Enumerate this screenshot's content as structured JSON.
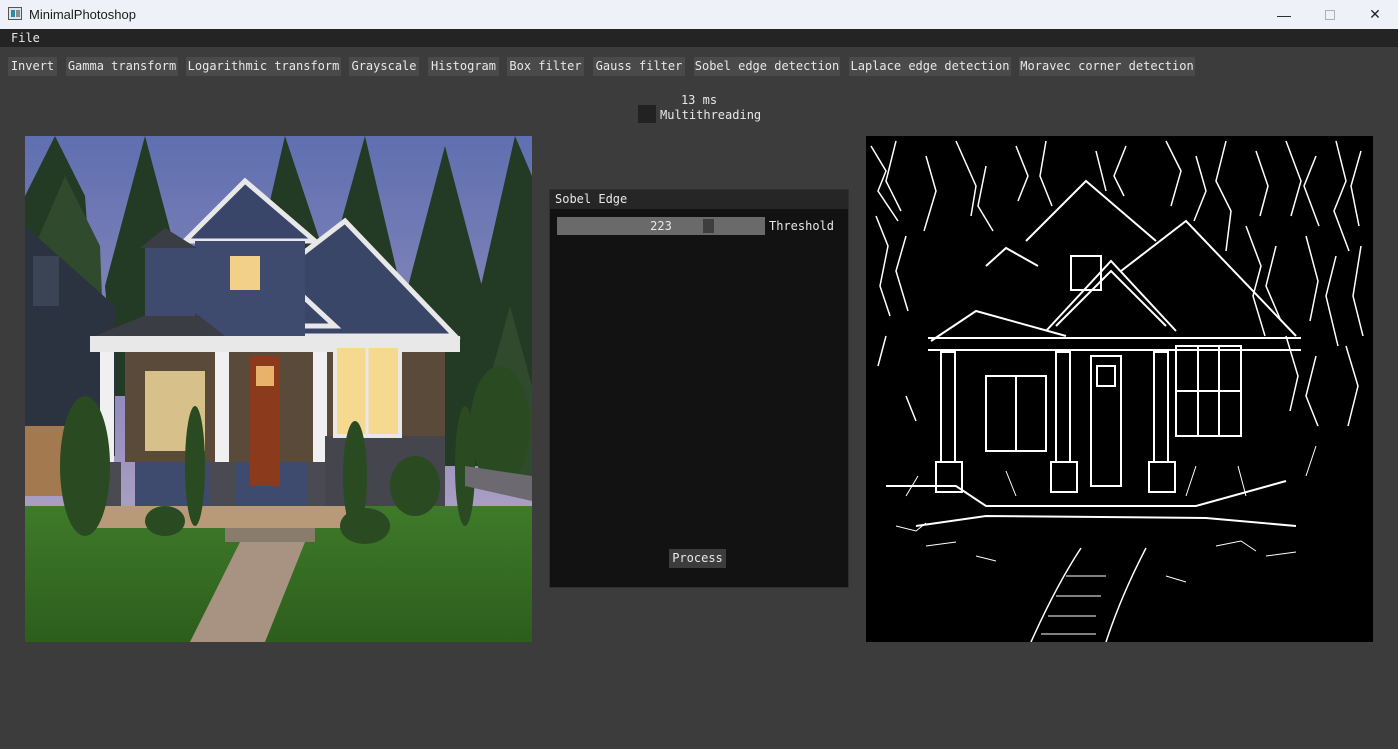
{
  "window": {
    "title": "MinimalPhotoshop",
    "minimize_glyph": "—",
    "close_glyph": "✕"
  },
  "menu": {
    "file": "File"
  },
  "toolbar": [
    "Invert",
    "Gamma transform",
    "Logarithmic transform",
    "Grayscale",
    "Histogram",
    "Box filter",
    "Gauss filter",
    "Sobel edge detection",
    "Laplace edge detection",
    "Moravec corner detection"
  ],
  "status": {
    "time": "13 ms",
    "multithreading_label": "Multithreading",
    "multithreading_checked": false
  },
  "panel": {
    "title": "Sobel Edge",
    "threshold_value": "223",
    "threshold_label": "Threshold",
    "process_label": "Process"
  },
  "images": {
    "input": "input-house-photo",
    "output": "sobel-edge-output"
  },
  "colors": {
    "background": "#3c3c3c",
    "button": "#4a4a4a",
    "menubar": "#242424",
    "panel": "#121212",
    "slider": "#6a6a6a"
  }
}
